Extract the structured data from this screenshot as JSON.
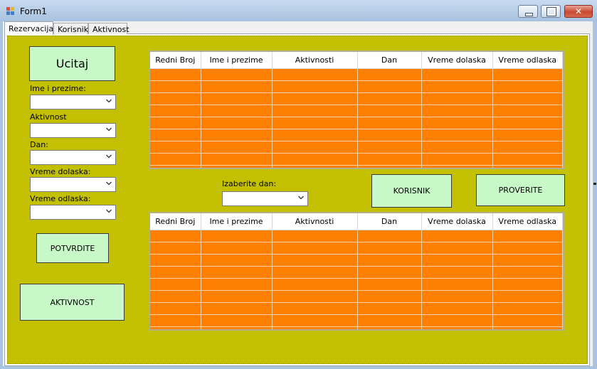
{
  "window": {
    "title": "Form1"
  },
  "tabs": [
    "Rezervacija",
    "Korisnik",
    "Aktivnost"
  ],
  "left": {
    "load_button": "Ucitaj",
    "name_label": "Ime i prezime:",
    "activity_label": "Aktivnost",
    "day_label": "Dan:",
    "arrival_label": "Vreme dolaska:",
    "departure_label": "Vreme odlaska:",
    "confirm_button": "POTVRDITE",
    "activity_button": "AKTIVNOST"
  },
  "middle": {
    "choose_day_label": "Izaberite dan:",
    "user_button": "KORISNIK",
    "check_button": "PROVERITE"
  },
  "grid_columns": [
    "Redni Broj",
    "Ime i prezime",
    "Aktivnosti",
    "Dan",
    "Vreme dolaska",
    "Vreme odlaska"
  ],
  "colors": {
    "panel": "#c2c000",
    "grid_background": "#ff7f00",
    "button": "#c8f8c8"
  },
  "icons": {
    "app": "form-app-icon",
    "dropdown": "chevron-down-icon"
  }
}
